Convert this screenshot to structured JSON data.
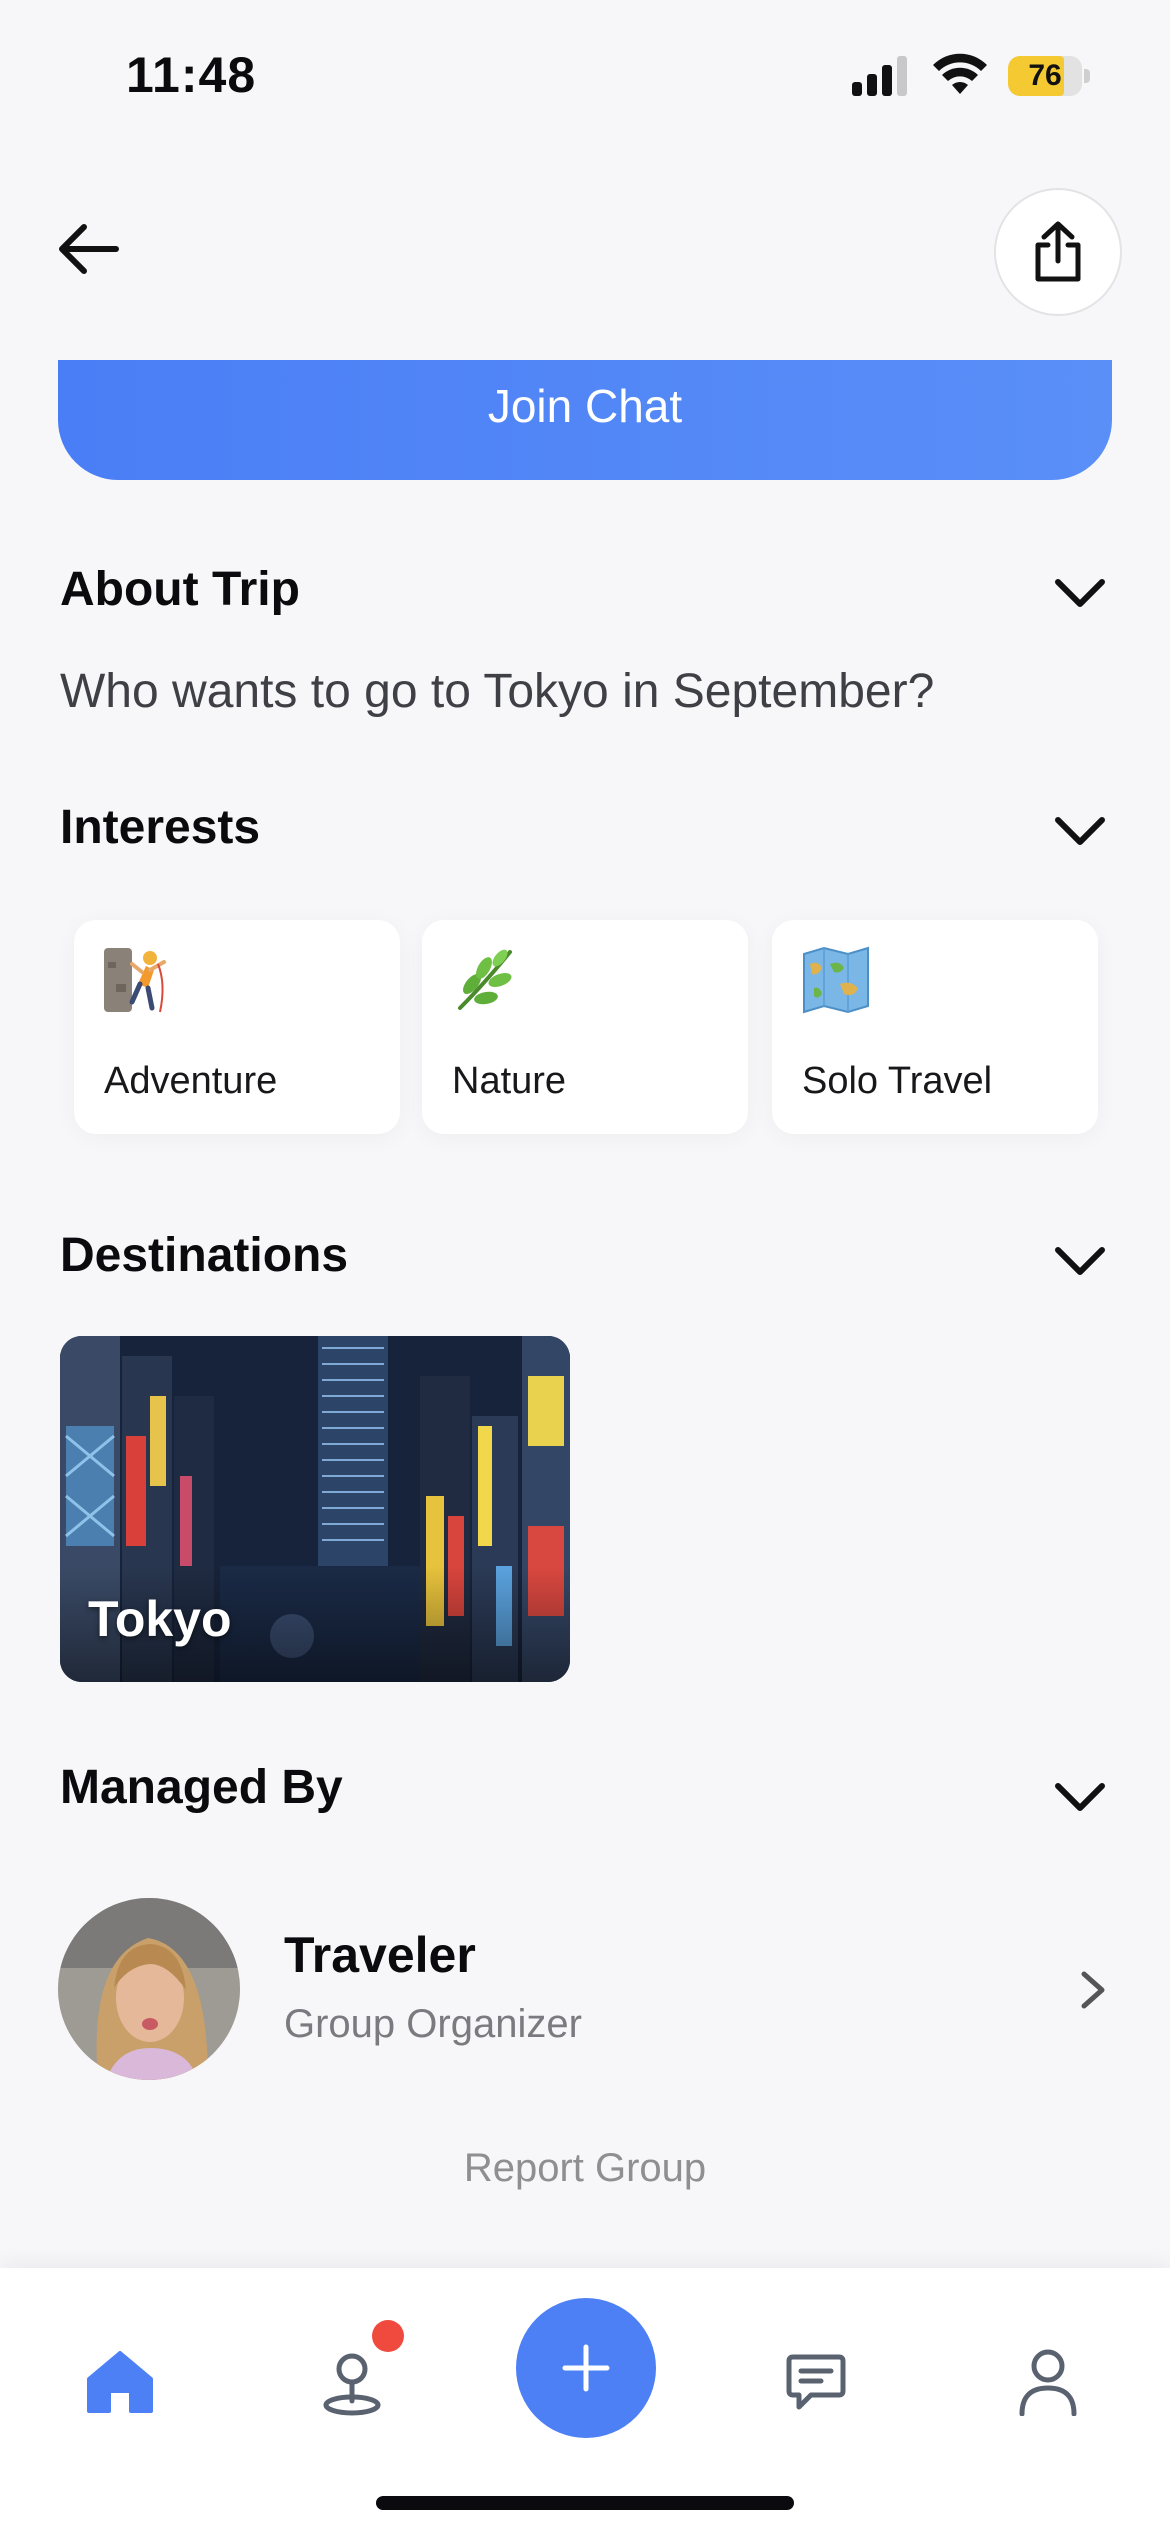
{
  "status_bar": {
    "time": "11:48",
    "battery_level": "76",
    "battery_fraction": 0.76
  },
  "header": {
    "back_icon": "arrow-left-icon",
    "share_icon": "share-icon"
  },
  "join_button": {
    "label": "Join Chat"
  },
  "about": {
    "title": "About Trip",
    "description": "Who wants to go to Tokyo in September?"
  },
  "interests": {
    "title": "Interests",
    "items": [
      {
        "label": "Adventure",
        "icon": "person-climbing-icon"
      },
      {
        "label": "Nature",
        "icon": "herb-icon"
      },
      {
        "label": "Solo Travel",
        "icon": "world-map-icon"
      }
    ]
  },
  "destinations": {
    "title": "Destinations",
    "items": [
      {
        "label": "Tokyo"
      }
    ]
  },
  "managed_by": {
    "title": "Managed By",
    "name": "Traveler",
    "role": "Group Organizer"
  },
  "report": {
    "label": "Report Group"
  },
  "tab_bar": {
    "items": [
      "home-icon",
      "map-pin-icon",
      "add-icon",
      "chat-icon",
      "profile-icon"
    ],
    "active_color": "#4d80f5",
    "inactive_color": "#5a6270",
    "notification_color": "#f04a3e"
  },
  "colors": {
    "accent": "#4d80f5",
    "background": "#f7f7f9"
  }
}
